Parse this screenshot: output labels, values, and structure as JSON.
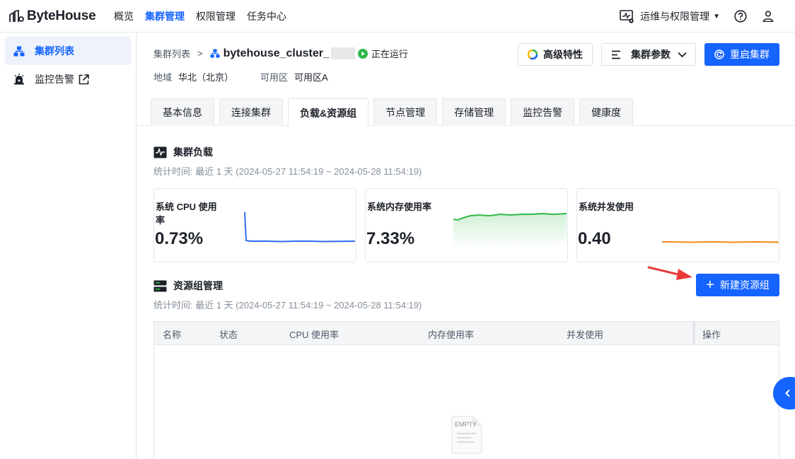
{
  "app": {
    "brand": "ByteHouse"
  },
  "topnav": {
    "items": [
      "概览",
      "集群管理",
      "权限管理",
      "任务中心"
    ],
    "active_index": 1
  },
  "user_menu": {
    "label": "运维与权限管理"
  },
  "sidebar": {
    "items": [
      {
        "label": "集群列表",
        "icon": "cluster-icon",
        "active": true
      },
      {
        "label": "监控告警",
        "icon": "alarm-icon",
        "external": true
      }
    ]
  },
  "breadcrumb": {
    "root": "集群列表",
    "separator": ">",
    "cluster_name": "bytehouse_cluster_",
    "status": "正在运行"
  },
  "meta": {
    "region_key": "地域",
    "region_value": "华北（北京）",
    "zone_key": "可用区",
    "zone_value": "可用区A"
  },
  "actions": {
    "advanced": "高级特性",
    "params": "集群参数",
    "restart": "重启集群"
  },
  "tabs": [
    "基本信息",
    "连接集群",
    "负载&资源组",
    "节点管理",
    "存储管理",
    "监控告警",
    "健康度"
  ],
  "active_tab_index": 2,
  "load_section": {
    "title": "集群负载",
    "subtitle": "统计时间: 最近 1 天 (2024-05-27 11:54:19 ~ 2024-05-28 11:54:19)",
    "cards": [
      {
        "title": "系统 CPU 使用率",
        "value": "0.73%",
        "color": "#2f6bf0"
      },
      {
        "title": "系统内存使用率",
        "value": "7.33%",
        "color": "#2fb84a"
      },
      {
        "title": "系统并发使用",
        "value": "0.40",
        "color": "#f08a1c"
      }
    ]
  },
  "resource_section": {
    "title": "资源组管理",
    "subtitle": "统计时间: 最近 1 天 (2024-05-27 11:54:19 ~ 2024-05-28 11:54:19)",
    "new_button": "新建资源组",
    "columns": [
      "名称",
      "状态",
      "CPU 使用率",
      "内存使用率",
      "并发使用",
      "操作"
    ],
    "empty_text": "EMPTY"
  },
  "colors": {
    "accent": "#1664ff",
    "running": "#2fb84a"
  }
}
